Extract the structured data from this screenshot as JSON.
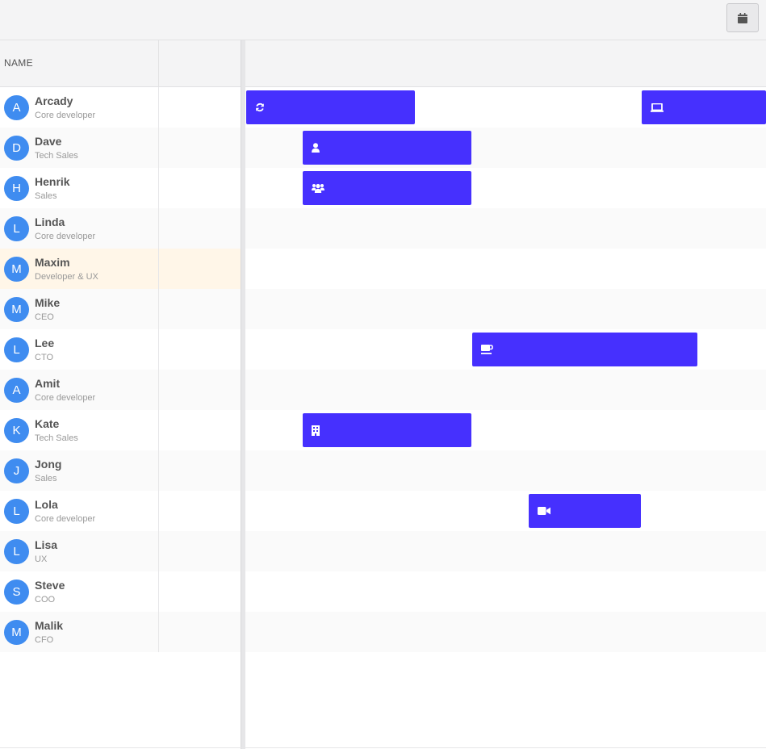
{
  "toolbar": {
    "calendar_button": "calendar-icon"
  },
  "header": {
    "name_column": "NAME"
  },
  "colors": {
    "avatar": "#3f8cf0",
    "event": "#4630fe",
    "highlight_row": "#fff6e8"
  },
  "resources": [
    {
      "initial": "A",
      "name": "Arcady",
      "role": "Core developer"
    },
    {
      "initial": "D",
      "name": "Dave",
      "role": "Tech Sales"
    },
    {
      "initial": "H",
      "name": "Henrik",
      "role": "Sales"
    },
    {
      "initial": "L",
      "name": "Linda",
      "role": "Core developer"
    },
    {
      "initial": "M",
      "name": "Maxim",
      "role": "Developer & UX"
    },
    {
      "initial": "M",
      "name": "Mike",
      "role": "CEO"
    },
    {
      "initial": "L",
      "name": "Lee",
      "role": "CTO"
    },
    {
      "initial": "A",
      "name": "Amit",
      "role": "Core developer"
    },
    {
      "initial": "K",
      "name": "Kate",
      "role": "Tech Sales"
    },
    {
      "initial": "J",
      "name": "Jong",
      "role": "Sales"
    },
    {
      "initial": "L",
      "name": "Lola",
      "role": "Core developer"
    },
    {
      "initial": "L",
      "name": "Lisa",
      "role": "UX"
    },
    {
      "initial": "S",
      "name": "Steve",
      "role": "COO"
    },
    {
      "initial": "M",
      "name": "Malik",
      "role": "CFO"
    }
  ],
  "events": [
    {
      "resource": "Arcady",
      "icon": "sync-icon"
    },
    {
      "resource": "Arcady",
      "icon": "laptop-icon"
    },
    {
      "resource": "Dave",
      "icon": "user-icon"
    },
    {
      "resource": "Henrik",
      "icon": "users-icon"
    },
    {
      "resource": "Lee",
      "icon": "coffee-icon"
    },
    {
      "resource": "Kate",
      "icon": "building-icon"
    },
    {
      "resource": "Lola",
      "icon": "video-icon"
    }
  ]
}
